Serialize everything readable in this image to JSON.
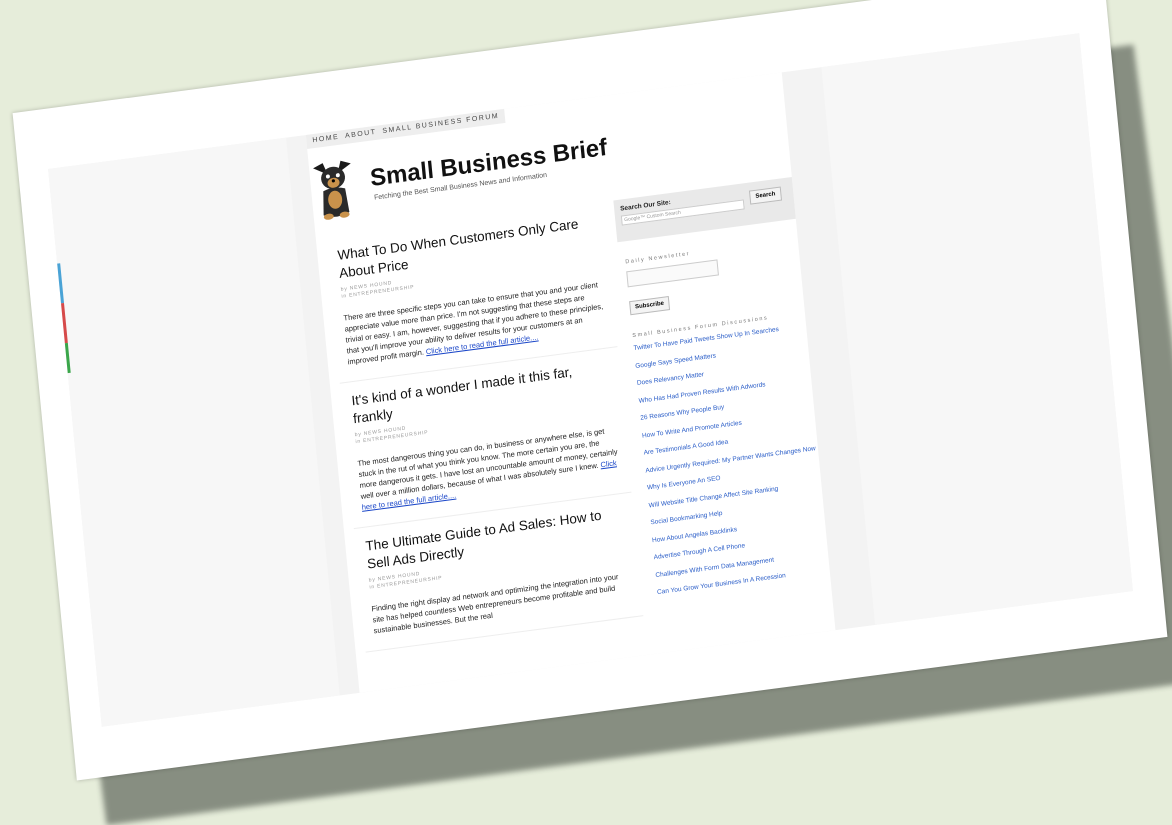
{
  "nav": [
    "HOME",
    "ABOUT",
    "SMALL BUSINESS FORUM"
  ],
  "site": {
    "title": "Small Business Brief",
    "tagline": "Fetching the Best Small Business News and Information"
  },
  "posts": [
    {
      "title": "What To Do When Customers Only Care About Price",
      "author": "by NEWS HOUND",
      "category": "in ENTREPRENEURSHIP",
      "excerpt": "There are three specific steps you can take to ensure that you and your client appreciate value more than price. I'm not suggesting that these steps are trivial or easy. I am, however, suggesting that if you adhere to these principles, that you'll improve your ability to deliver results for your customers at an improved profit margin.",
      "more": "Click here to read the full article...."
    },
    {
      "title": "It's kind of a wonder I made it this far, frankly",
      "author": "by NEWS HOUND",
      "category": "in ENTREPRENEURSHIP",
      "excerpt": "The most dangerous thing you can do, in business or anywhere else, is get stuck in the rut of what you think you know. The more certain you are, the more dangerous it gets. I have lost an uncountable amount of money, certainly well over a million dollars, because of what I was absolutely sure I knew.",
      "more": "Click here to read the full article...."
    },
    {
      "title": "The Ultimate Guide to Ad Sales: How to Sell Ads Directly",
      "author": "by NEWS HOUND",
      "category": "in ENTREPRENEURSHIP",
      "excerpt": "Finding the right display ad network and optimizing the integration into your site has helped countless Web entrepreneurs become profitable and build sustainable businesses. But the real",
      "more": ""
    }
  ],
  "sidebar": {
    "search_label": "Search Our Site:",
    "search_placeholder": "Google™ Custom Search",
    "search_button": "Search",
    "newsletter_heading": "Daily Newsletter",
    "subscribe_button": "Subscribe",
    "forum_heading": "Small Business Forum Discussions",
    "forum_links": [
      "Twitter To Have Paid Tweets Show Up In Searches",
      "Google Says Speed Matters",
      "Does Relevancy Matter",
      "Who Has Had Proven Results With Adwords",
      "26 Reasons Why People Buy",
      "How To Write And Promote Articles",
      "Are Testimonials A Good Idea",
      "Advice Urgently Required: My Partner Wants Changes Now",
      "Why Is Everyone An SEO",
      "Will Website Title Change Affect Site Ranking",
      "Social Bookmarking Help",
      "How About Angelas Backlinks",
      "Advertise Through A Cell Phone",
      "Challenges With Form Data Management",
      "Can You Grow Your Business In A Recession"
    ]
  },
  "colors": {
    "background": "#e6edda",
    "link": "#2b5ec8",
    "accent_lines": [
      "#4aa3d6",
      "#d64a4a",
      "#3aa64a"
    ]
  }
}
